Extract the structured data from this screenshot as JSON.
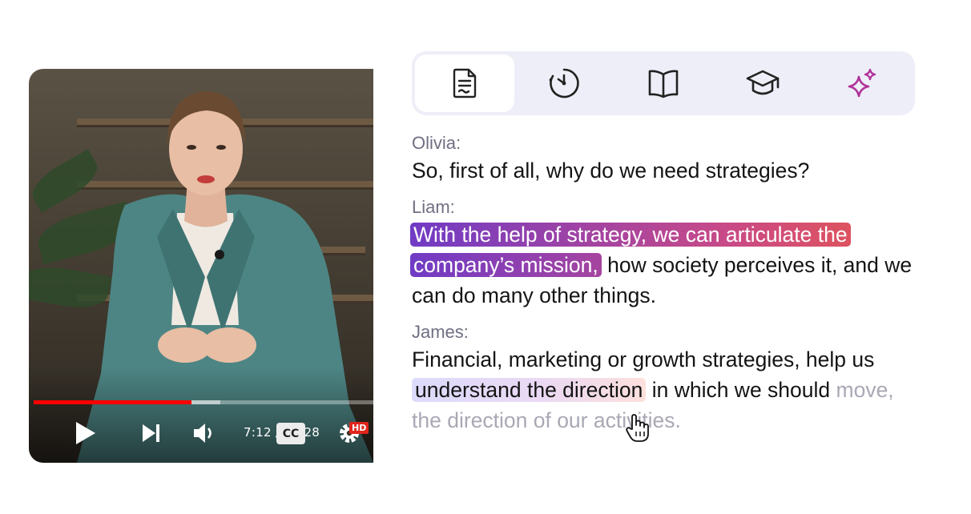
{
  "player": {
    "current_time": "7:12",
    "time_separator": "/",
    "duration": "15:28",
    "progress_fraction": 0.465,
    "buffered_fraction": 0.55,
    "cc_label": "CC",
    "hd_label": "HD",
    "colors": {
      "played": "#ff0000"
    }
  },
  "tabs": [
    {
      "icon": "document-icon",
      "active": true
    },
    {
      "icon": "timer-icon",
      "active": false
    },
    {
      "icon": "open-book-icon",
      "active": false
    },
    {
      "icon": "graduation-cap-icon",
      "active": false
    },
    {
      "icon": "sparkles-icon",
      "active": false
    }
  ],
  "transcript": {
    "entries": [
      {
        "speaker": "Olivia:",
        "text": "So, first of all, why do we need strategies?"
      },
      {
        "speaker": "Liam:",
        "highlighted": "With the help of strategy, we can articulate the company’s mission,",
        "rest": " how society perceives it, and we can do many other things."
      },
      {
        "speaker": "James:",
        "before": "Financial, marketing or growth strategies, help us ",
        "highlighted": "understand the direction",
        "after": " in which we should ",
        "faded": "move, the direction of our activities."
      }
    ]
  },
  "colors": {
    "tabbar_bg": "#eeeef8",
    "highlight_start": "#3c32f0",
    "highlight_end": "#f25a38",
    "sparkle_accent": "#b0349a"
  }
}
